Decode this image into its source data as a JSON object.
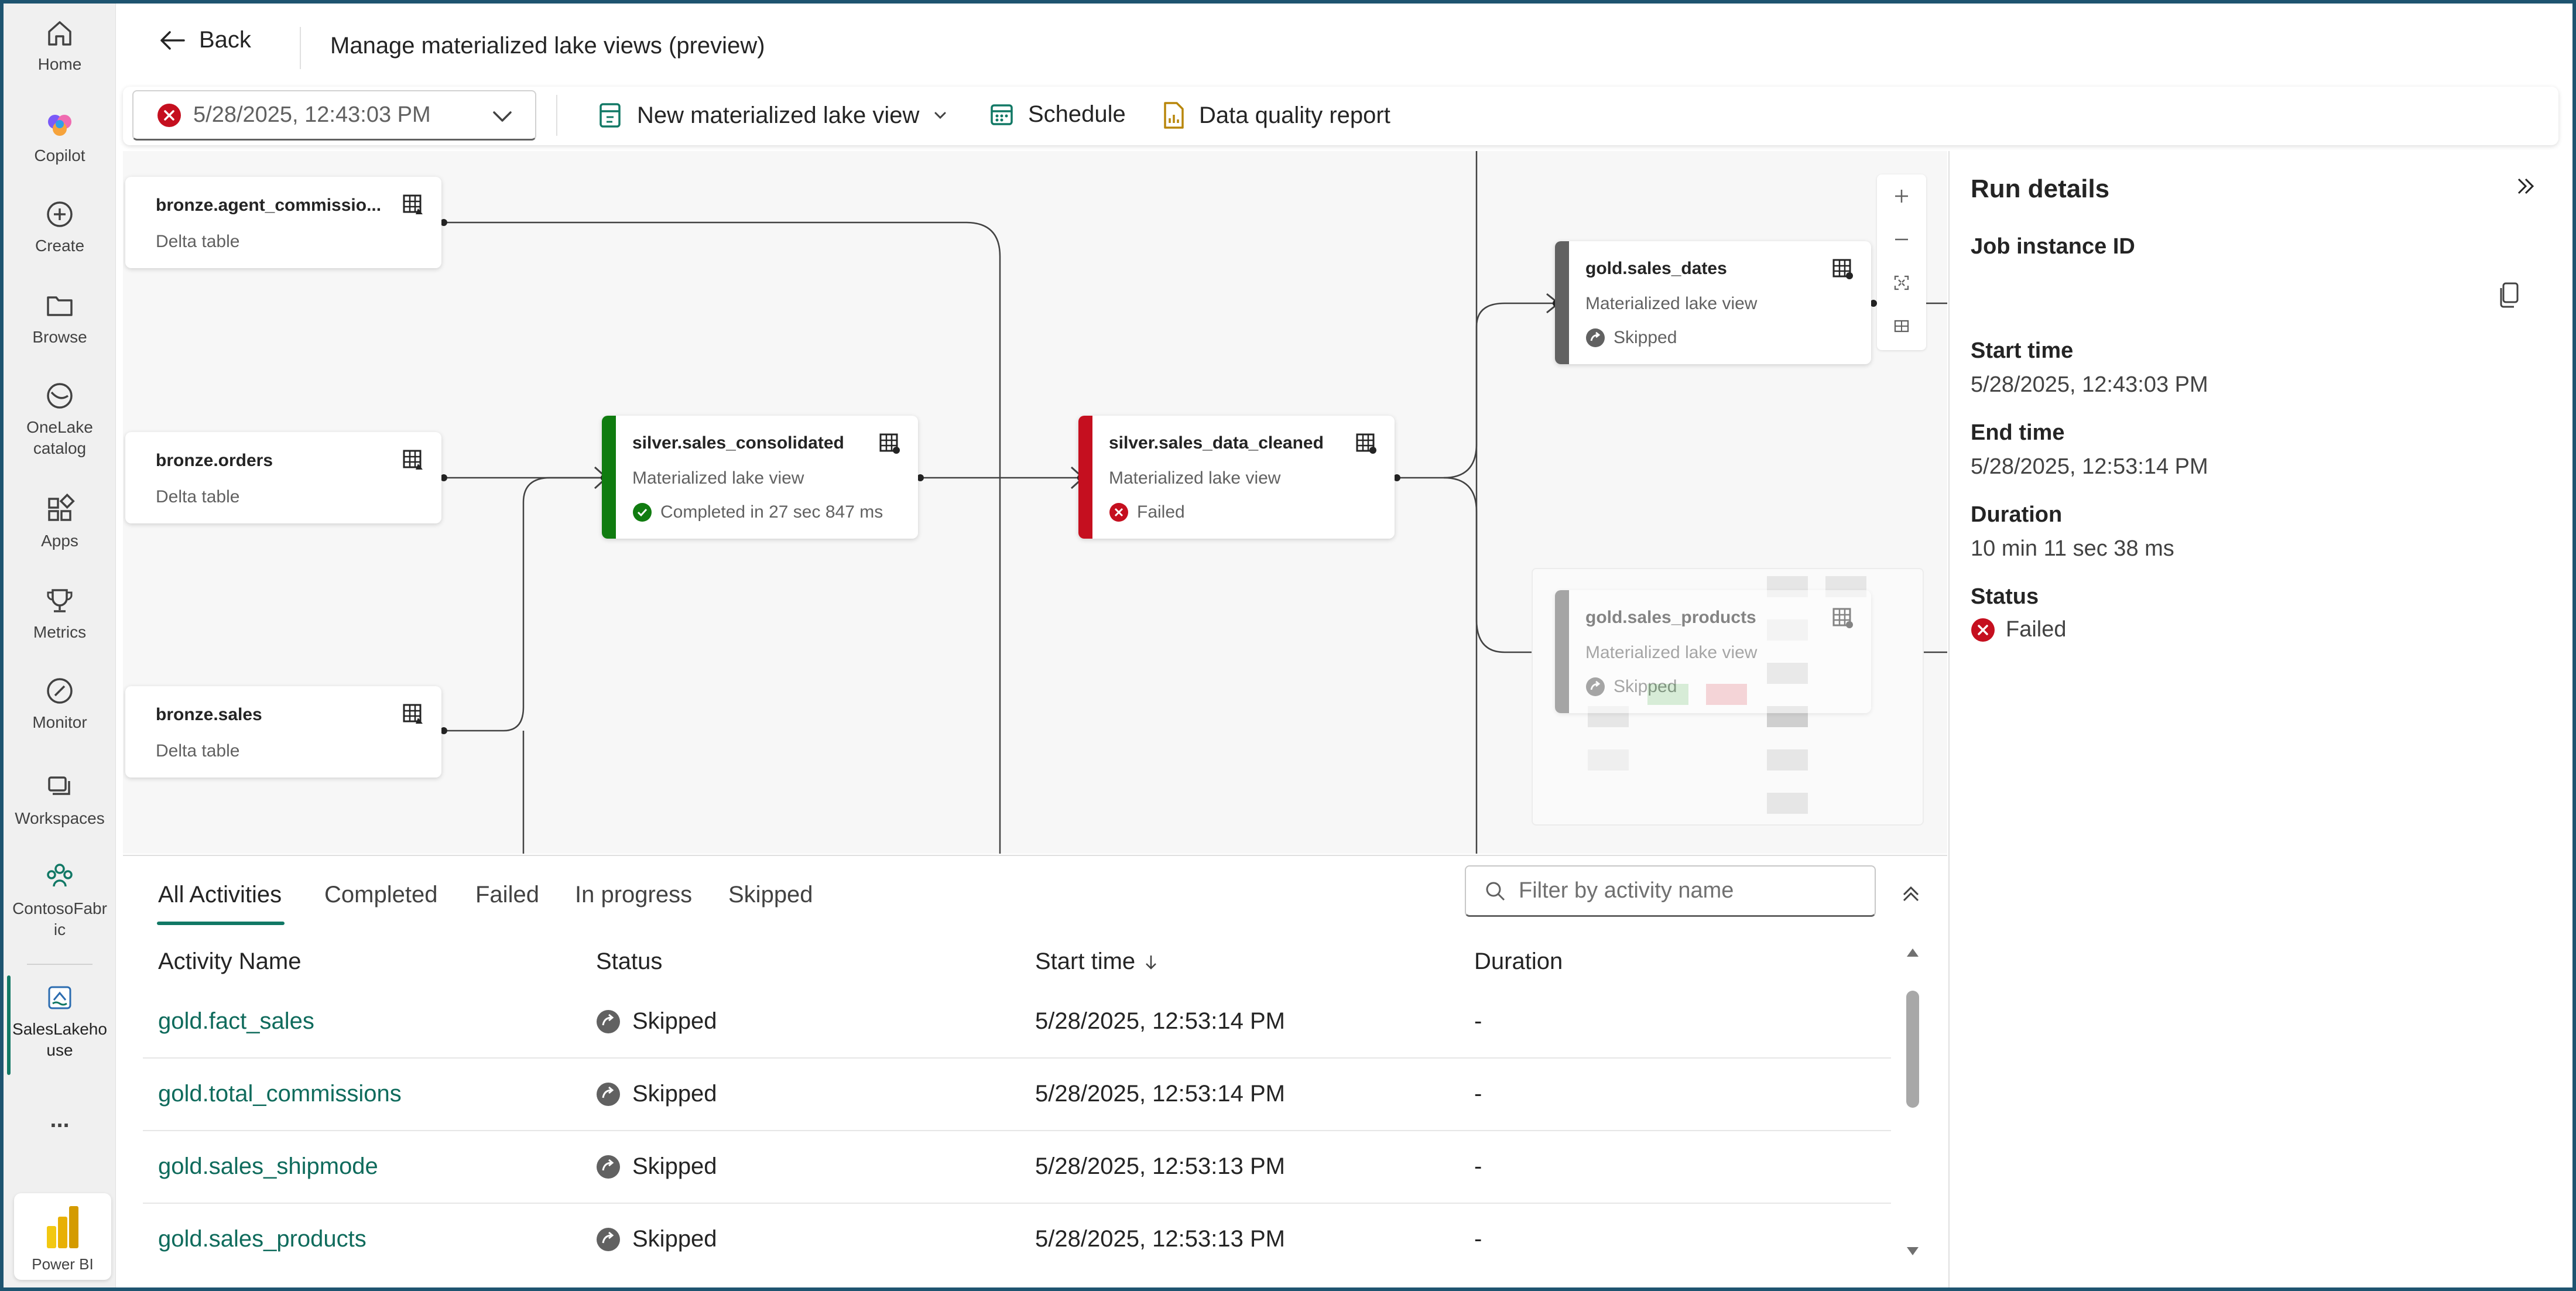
{
  "rail": {
    "items": [
      {
        "label": "Home",
        "icon": "home-icon"
      },
      {
        "label": "Copilot",
        "icon": "copilot-icon"
      },
      {
        "label": "Create",
        "icon": "plus-circle-icon"
      },
      {
        "label": "Browse",
        "icon": "folder-icon"
      },
      {
        "label": "OneLake\ncatalog",
        "icon": "onelake-icon"
      },
      {
        "label": "Apps",
        "icon": "apps-icon"
      },
      {
        "label": "Metrics",
        "icon": "trophy-icon"
      },
      {
        "label": "Monitor",
        "icon": "monitor-icon"
      },
      {
        "label": "Workspaces",
        "icon": "workspaces-icon"
      },
      {
        "label": "ContosoFabr\nic",
        "icon": "people-icon"
      },
      {
        "label": "SalesLakeho\nuse",
        "icon": "lakehouse-icon"
      }
    ],
    "more": "...",
    "powerbi": "Power BI"
  },
  "header": {
    "back": "Back",
    "title": "Manage materialized lake views (preview)"
  },
  "toolbar": {
    "run_selector": "5/28/2025, 12:43:03 PM",
    "new_mlv": "New materialized lake view",
    "schedule": "Schedule",
    "dq_report": "Data quality report"
  },
  "graph": {
    "nodes": [
      {
        "name": "bronze.agent_commissio...",
        "type": "Delta table"
      },
      {
        "name": "bronze.orders",
        "type": "Delta table"
      },
      {
        "name": "bronze.sales",
        "type": "Delta table"
      },
      {
        "name": "silver.sales_consolidated",
        "type": "Materialized lake view",
        "status": "Completed in 27 sec 847 ms"
      },
      {
        "name": "silver.sales_data_cleaned",
        "type": "Materialized lake view",
        "status": "Failed"
      },
      {
        "name": "gold.sales_dates",
        "type": "Materialized lake view",
        "status": "Skipped"
      },
      {
        "name": "gold.sales_products",
        "type": "Materialized lake view",
        "status": "Skipped"
      }
    ],
    "colors": {
      "completed": "#107c10",
      "failed": "#c50f1f",
      "skipped": "#616161"
    }
  },
  "details": {
    "title": "Run details",
    "job_label": "Job instance ID",
    "start_label": "Start time",
    "start_value": "5/28/2025, 12:43:03 PM",
    "end_label": "End time",
    "end_value": "5/28/2025, 12:53:14 PM",
    "duration_label": "Duration",
    "duration_value": "10 min 11 sec 38 ms",
    "status_label": "Status",
    "status_value": "Failed"
  },
  "activities": {
    "tabs": [
      "All Activities",
      "Completed",
      "Failed",
      "In progress",
      "Skipped"
    ],
    "filter_placeholder": "Filter by activity name",
    "columns": [
      "Activity Name",
      "Status",
      "Start time",
      "Duration"
    ],
    "rows": [
      {
        "name": "gold.fact_sales",
        "status": "Skipped",
        "start": "5/28/2025, 12:53:14 PM",
        "duration": "-"
      },
      {
        "name": "gold.total_commissions",
        "status": "Skipped",
        "start": "5/28/2025, 12:53:14 PM",
        "duration": "-"
      },
      {
        "name": "gold.sales_shipmode",
        "status": "Skipped",
        "start": "5/28/2025, 12:53:13 PM",
        "duration": "-"
      },
      {
        "name": "gold.sales_products",
        "status": "Skipped",
        "start": "5/28/2025, 12:53:13 PM",
        "duration": "-"
      }
    ]
  }
}
